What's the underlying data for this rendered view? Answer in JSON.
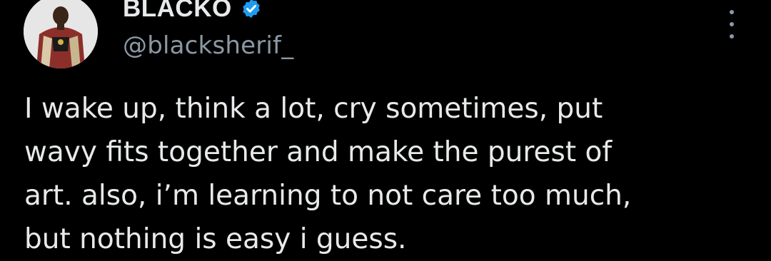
{
  "author": {
    "display_name": "BLACKO",
    "handle": "@blacksherif_",
    "verified": true
  },
  "tweet": {
    "lines": [
      "I wake up, think a lot, cry sometimes, put",
      "wavy fits together and make the purest of",
      "art. also, i’m learning to not care too much,",
      "but nothing is easy i guess."
    ]
  },
  "icons": {
    "verified_badge": "verified-badge-icon",
    "more_options": "more-options-icon"
  },
  "colors": {
    "background": "#000000",
    "primary_text": "#e7e9ea",
    "secondary_text": "#8b98a5",
    "verified_blue": "#1d9bf0"
  }
}
